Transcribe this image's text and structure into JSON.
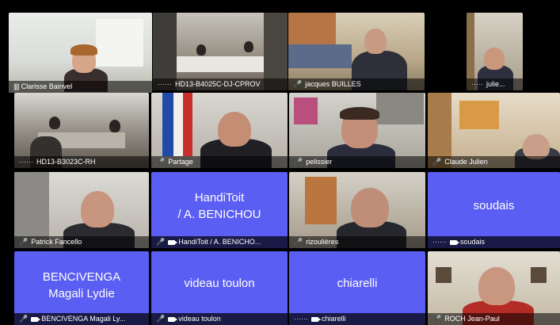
{
  "participants": [
    {
      "name": "Clarisse Bainvel",
      "type": "video",
      "active": true,
      "status_icon": "audio-bars-icon"
    },
    {
      "name": "HD13-B4025C-DJ-CPROV",
      "type": "video",
      "status_icon": "dots-line"
    },
    {
      "name": "jacques BUILLES",
      "type": "video",
      "status_icon": "mic-muted-icon"
    },
    {
      "name": "julie...",
      "type": "video",
      "status_icon": "dots-line"
    },
    {
      "name": "HD13-B3023C-RH",
      "type": "video",
      "status_icon": "dots-line"
    },
    {
      "name": "Partage",
      "type": "video",
      "status_icon": "mic-muted-icon"
    },
    {
      "name": "pelissier",
      "type": "video",
      "status_icon": "mic-muted-icon"
    },
    {
      "name": "Claude Julien",
      "type": "video",
      "status_icon": "mic-muted-icon"
    },
    {
      "name": "Patrick Fancello",
      "type": "video",
      "status_icon": "mic-muted-icon"
    },
    {
      "name": "HandiToit / A. BENICHO...",
      "type": "avatar",
      "display": "HandiToit\n/ A. BENICHOU",
      "status_icon": "mic-muted-icon"
    },
    {
      "name": "rizoulières",
      "type": "video",
      "status_icon": "mic-muted-icon"
    },
    {
      "name": "soudais",
      "type": "avatar",
      "display": "soudais",
      "status_icon": "dots-line"
    },
    {
      "name": "BENCIVENGA Magali Ly...",
      "type": "avatar",
      "display": "BENCIVENGA\nMagali Lydie",
      "status_icon": "mic-muted-icon"
    },
    {
      "name": "videau toulon",
      "type": "avatar",
      "display": "videau toulon",
      "status_icon": "mic-muted-icon"
    },
    {
      "name": "chiarelli",
      "type": "avatar",
      "display": "chiarelli",
      "status_icon": "dots-line"
    },
    {
      "name": "ROCH Jean-Paul",
      "type": "video",
      "status_icon": "mic-muted-icon"
    }
  ],
  "colors": {
    "avatar_bg": "#5b5ef2",
    "active_border": "#f1c232",
    "background": "#000000"
  }
}
